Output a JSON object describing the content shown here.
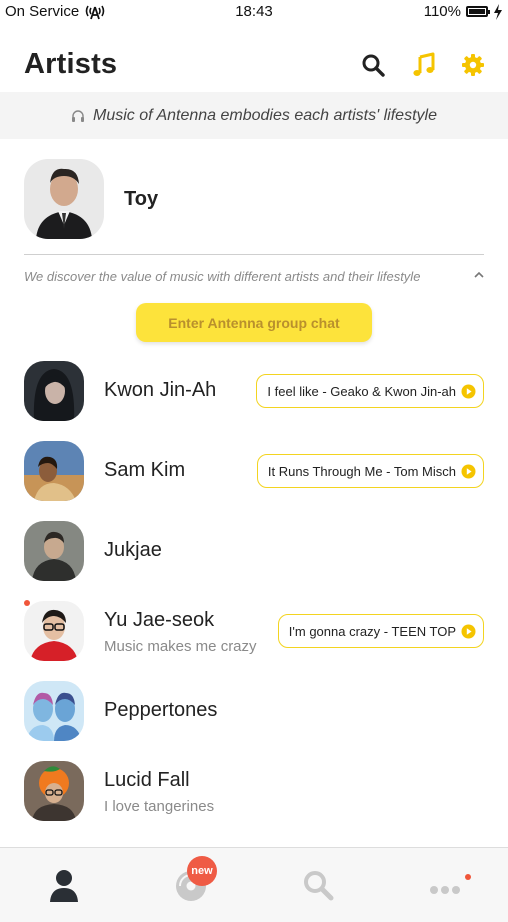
{
  "status_bar": {
    "carrier": "On Service",
    "time": "18:43",
    "battery": "110%"
  },
  "header": {
    "title": "Artists",
    "icons": [
      "search-icon",
      "music-note-icon",
      "gear-icon"
    ]
  },
  "banner": {
    "text": "Music of Antenna embodies each artists' lifestyle"
  },
  "profile": {
    "name": "Toy"
  },
  "group": {
    "description": "We discover the value of music with different artists and their lifestyle",
    "chat_button": "Enter Antenna group chat"
  },
  "artists": [
    {
      "name": "Kwon Jin-Ah",
      "status": "",
      "song": "I feel like - Geako & Kwon Jin-ah"
    },
    {
      "name": "Sam Kim",
      "status": "",
      "song": "It Runs Through Me - Tom Misch"
    },
    {
      "name": "Jukjae",
      "status": "",
      "song": ""
    },
    {
      "name": "Yu Jae-seok",
      "status": "Music makes me crazy",
      "song": "I'm gonna crazy - TEEN TOP"
    },
    {
      "name": "Peppertones",
      "status": "",
      "song": ""
    },
    {
      "name": "Lucid Fall",
      "status": "I love tangerines",
      "song": ""
    }
  ],
  "tabs": {
    "badge": "new",
    "items": [
      "person-icon",
      "disc-icon",
      "search-icon",
      "more-icon"
    ]
  },
  "colors": {
    "accent": "#fde33b",
    "icon_yellow": "#f5c400",
    "badge_red": "#ef5b45"
  }
}
